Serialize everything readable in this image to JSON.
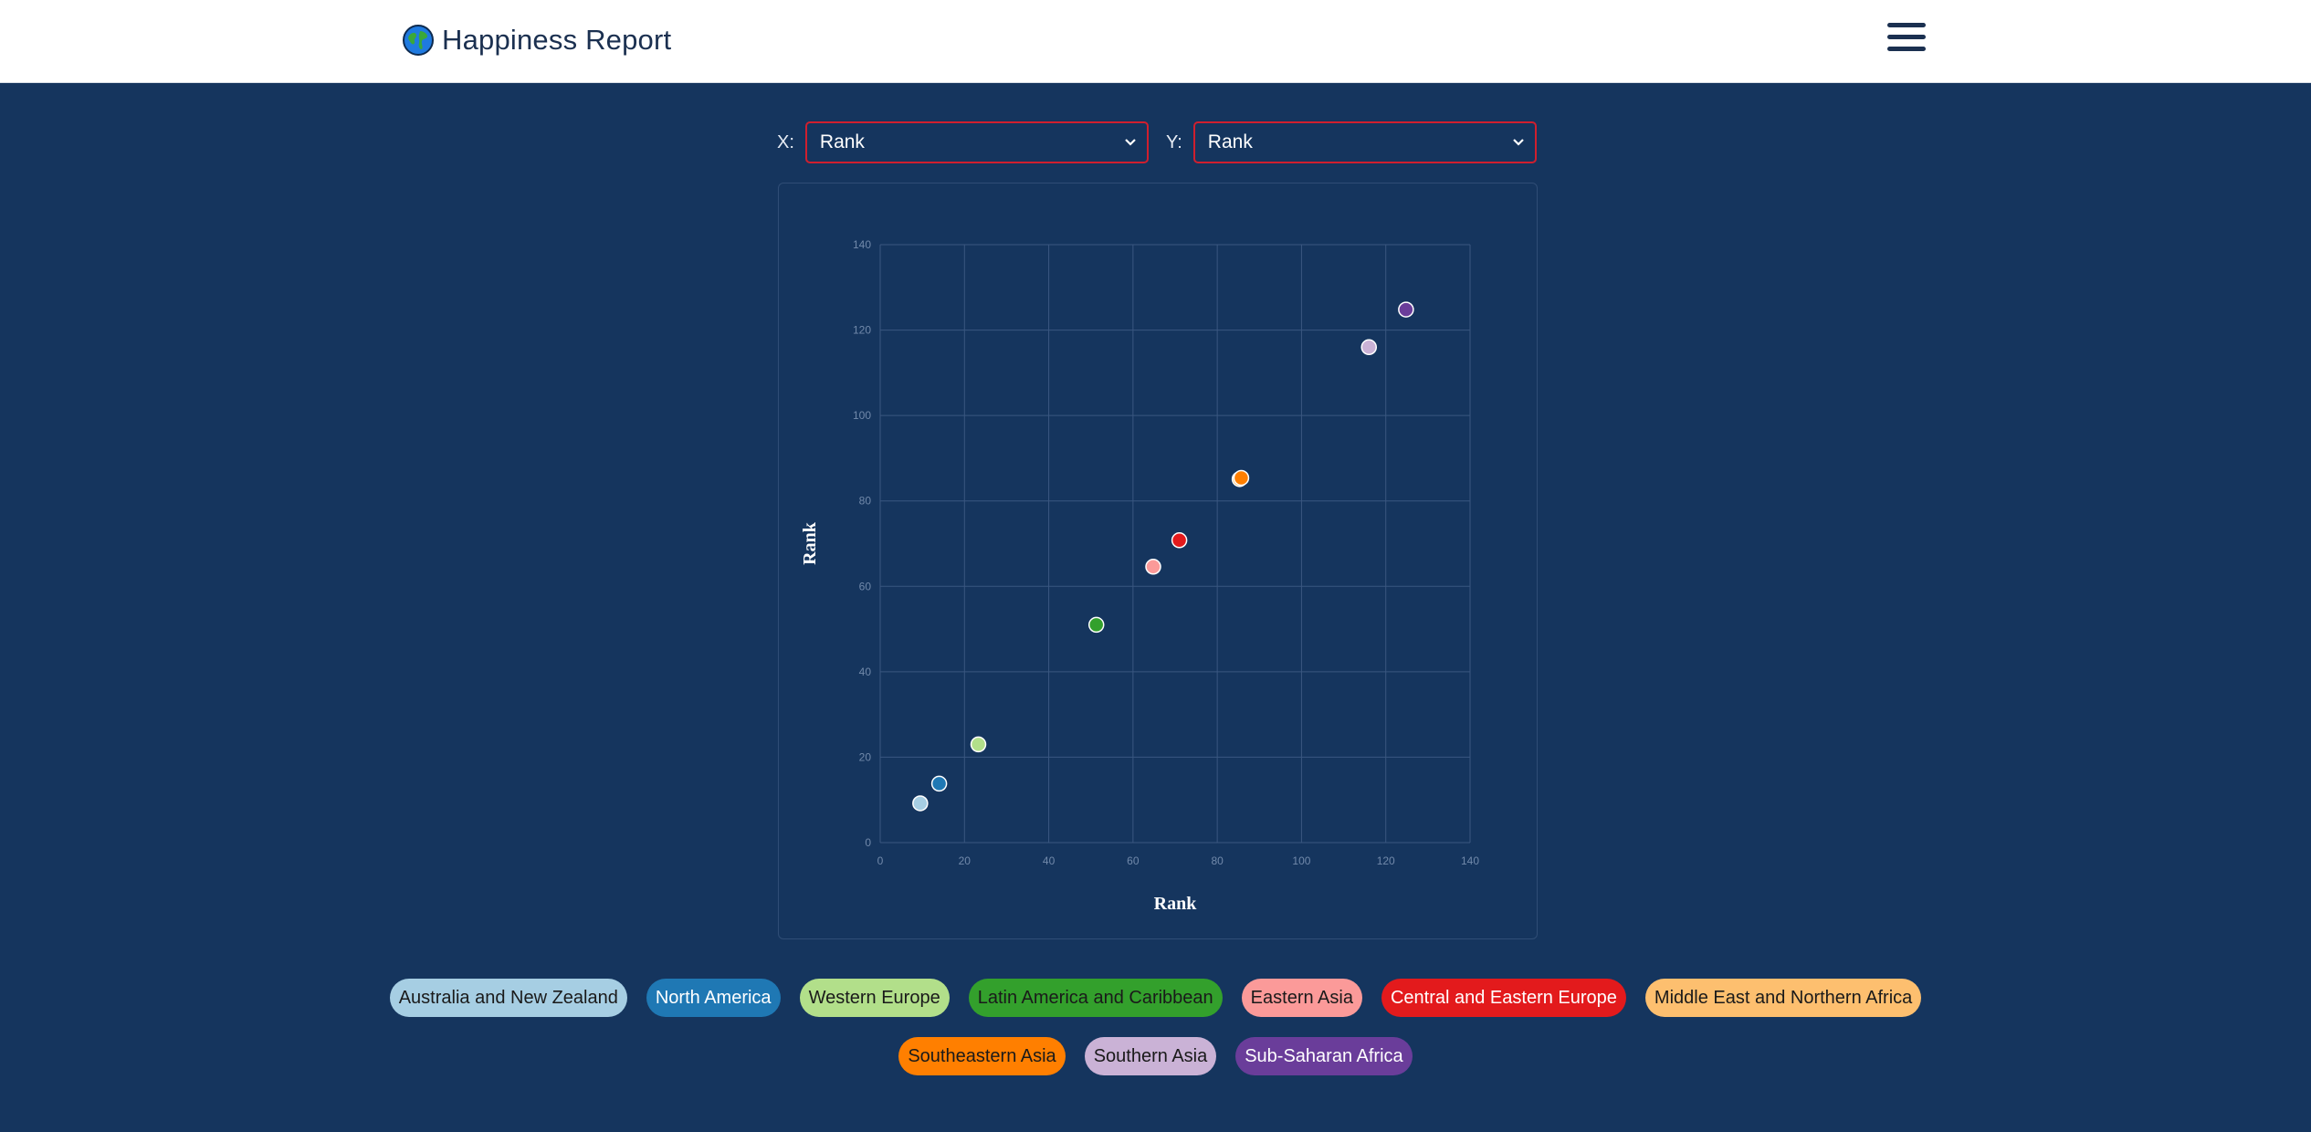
{
  "header": {
    "title": "Happiness Report"
  },
  "controls": {
    "x_label": "X:",
    "x_value": "Rank",
    "y_label": "Y:",
    "y_value": "Rank"
  },
  "icons": {
    "logo": "globe-icon",
    "menu": "hamburger-menu-icon",
    "select": "chevron-down-icon"
  },
  "colors": {
    "background": "#15355e",
    "header": "#ffffff",
    "select_border": "#d01f2e"
  },
  "chart_data": {
    "type": "scatter",
    "xlabel": "Rank",
    "ylabel": "Rank",
    "xlim": [
      0,
      140
    ],
    "ylim": [
      0,
      140
    ],
    "x_ticks": [
      0,
      20,
      40,
      60,
      80,
      100,
      120,
      140
    ],
    "y_ticks": [
      0,
      20,
      40,
      60,
      80,
      100,
      120,
      140
    ],
    "grid": true,
    "series": [
      {
        "name": "Australia and New Zealand",
        "color": "#a6cee3",
        "x": [
          9.5
        ],
        "y": [
          9.2
        ]
      },
      {
        "name": "North America",
        "color": "#1f78b4",
        "x": [
          14
        ],
        "y": [
          13.8
        ]
      },
      {
        "name": "Western Europe",
        "color": "#b2df8a",
        "x": [
          23.3
        ],
        "y": [
          23
        ]
      },
      {
        "name": "Latin America and Caribbean",
        "color": "#33a02c",
        "x": [
          51.3
        ],
        "y": [
          51
        ]
      },
      {
        "name": "Eastern Asia",
        "color": "#fb9a99",
        "x": [
          64.8
        ],
        "y": [
          64.6
        ]
      },
      {
        "name": "Central and Eastern Europe",
        "color": "#e31a1c",
        "x": [
          71
        ],
        "y": [
          70.8
        ]
      },
      {
        "name": "Middle East and Northern Africa",
        "color": "#fdbf6f",
        "x": [
          85.3
        ],
        "y": [
          85.1
        ]
      },
      {
        "name": "Southeastern Asia",
        "color": "#ff7f00",
        "x": [
          85.7
        ],
        "y": [
          85.4
        ]
      },
      {
        "name": "Southern Asia",
        "color": "#cab2d6",
        "x": [
          116
        ],
        "y": [
          116
        ]
      },
      {
        "name": "Sub-Saharan Africa",
        "color": "#6a3d9a",
        "x": [
          124.8
        ],
        "y": [
          124.8
        ]
      }
    ]
  },
  "legend": {
    "row1": [
      {
        "label": "Australia and New Zealand",
        "bg": "#a6cee3",
        "fg": "#1a1a1a"
      },
      {
        "label": "North America",
        "bg": "#1f78b4",
        "fg": "#ffffff"
      },
      {
        "label": "Western Europe",
        "bg": "#b2df8a",
        "fg": "#1a1a1a"
      },
      {
        "label": "Latin America and Caribbean",
        "bg": "#33a02c",
        "fg": "#1a1a1a"
      },
      {
        "label": "Eastern Asia",
        "bg": "#fb9a99",
        "fg": "#1a1a1a"
      },
      {
        "label": "Central and Eastern Europe",
        "bg": "#e31a1c",
        "fg": "#ffffff"
      },
      {
        "label": "Middle East and Northern Africa",
        "bg": "#fdbf6f",
        "fg": "#1a1a1a"
      }
    ],
    "row2": [
      {
        "label": "Southeastern Asia",
        "bg": "#ff7f00",
        "fg": "#1a1a1a"
      },
      {
        "label": "Southern Asia",
        "bg": "#cab2d6",
        "fg": "#1a1a1a"
      },
      {
        "label": "Sub-Saharan Africa",
        "bg": "#6a3d9a",
        "fg": "#ffffff"
      }
    ]
  }
}
